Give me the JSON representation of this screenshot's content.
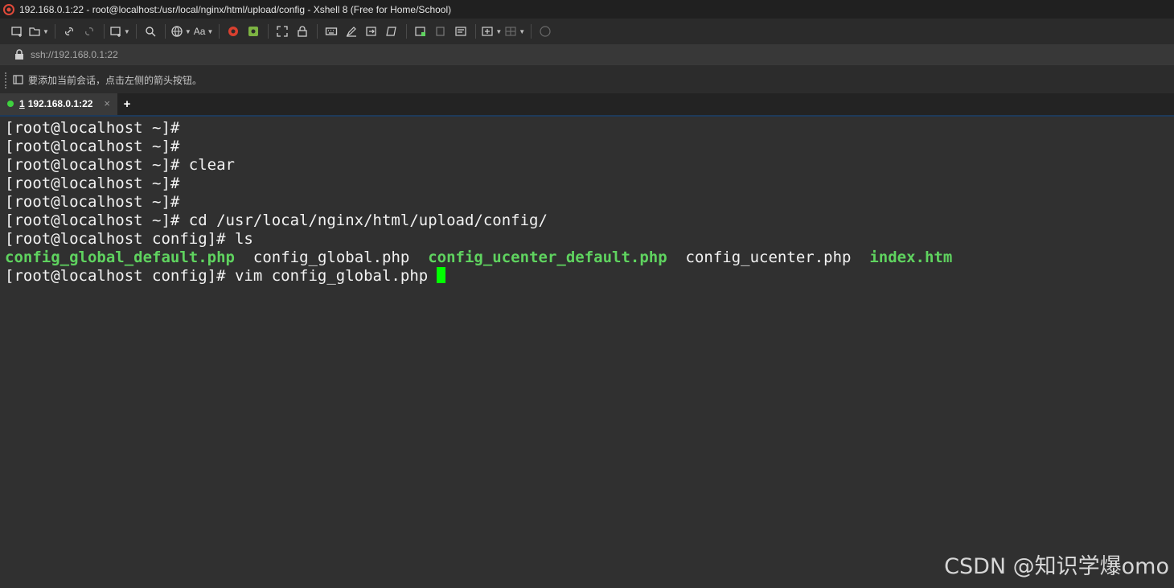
{
  "window": {
    "title": "192.168.0.1:22 - root@localhost:/usr/local/nginx/html/upload/config - Xshell 8 (Free for Home/School)"
  },
  "toolbar": {
    "font_label": "Aa"
  },
  "address": {
    "url": "ssh://192.168.0.1:22"
  },
  "session_bar": {
    "hint": "要添加当前会话，点击左侧的箭头按钮。"
  },
  "tabs": [
    {
      "number": "1",
      "label": "192.168.0.1:22",
      "close": "×"
    }
  ],
  "add_tab_label": "+",
  "terminal": {
    "lines": [
      "[root@localhost ~]#",
      "[root@localhost ~]#",
      "[root@localhost ~]# clear",
      "[root@localhost ~]#",
      "[root@localhost ~]#",
      "[root@localhost ~]# cd /usr/local/nginx/html/upload/config/",
      "[root@localhost config]# ls"
    ],
    "ls_output": [
      {
        "name": "config_global_default.php",
        "highlight": true
      },
      {
        "name": "config_global.php",
        "highlight": false
      },
      {
        "name": "config_ucenter_default.php",
        "highlight": true
      },
      {
        "name": "config_ucenter.php",
        "highlight": false
      },
      {
        "name": "index.htm",
        "highlight": true
      }
    ],
    "current_prompt": "[root@localhost config]# vim config_global.php",
    "cursor_color": "#00ff00",
    "highlight_color": "#5fd35f"
  },
  "watermark": "CSDN @知识学爆omo"
}
